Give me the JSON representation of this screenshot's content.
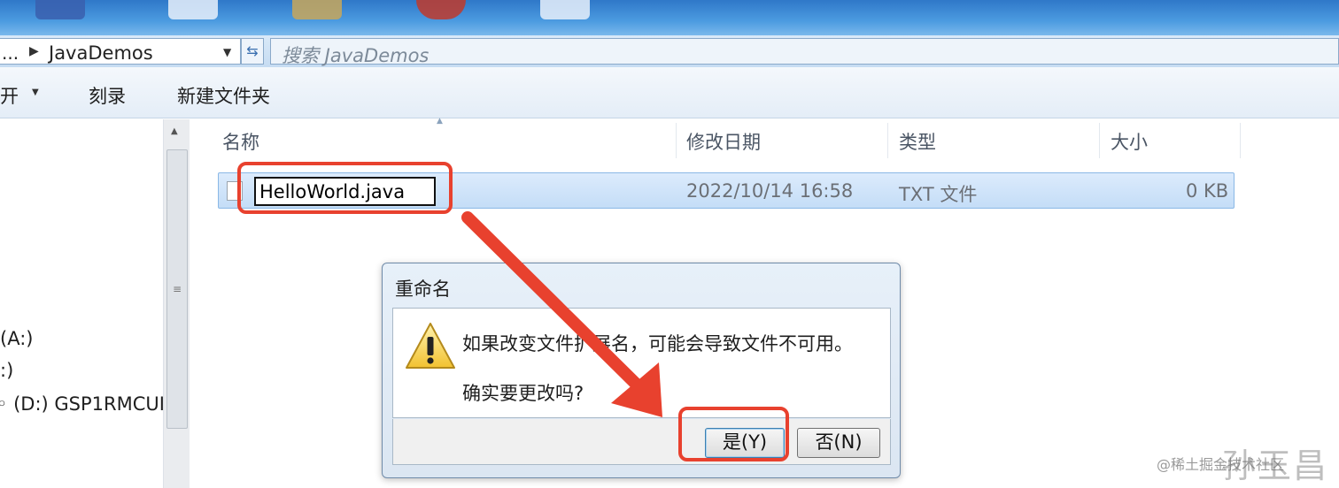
{
  "top_strip": {
    "icon_colors": [
      "#3a5fae",
      "#e8f0fa",
      "#c8a75a",
      "#c0392b",
      "#e8f0fa"
    ]
  },
  "address_bar": {
    "prefix": "...",
    "path": "JavaDemos",
    "search_placeholder": "搜索 JavaDemos"
  },
  "toolbar": {
    "open_label": "开",
    "burn_label": "刻录",
    "new_folder_label": "新建文件夹"
  },
  "nav": {
    "items": [
      "(A:)",
      ":)",
      "(D:) GSP1RMCUI"
    ]
  },
  "columns": {
    "name": "名称",
    "modified": "修改日期",
    "type": "类型",
    "size": "大小"
  },
  "file": {
    "name": "HelloWorld.java",
    "modified": "2022/10/14 16:58",
    "type": "TXT 文件",
    "size": "0 KB"
  },
  "dialog": {
    "title": "重命名",
    "message": "如果改变文件扩展名，可能会导致文件不可用。",
    "question": "确实要更改吗?",
    "yes_label": "是(Y)",
    "no_label": "否(N)"
  },
  "colors": {
    "annotation": "#e8412e",
    "selection": "#cce4f9"
  },
  "watermark": {
    "text": "@稀土掘金技术社区",
    "logo_text": "孙玉昌"
  }
}
